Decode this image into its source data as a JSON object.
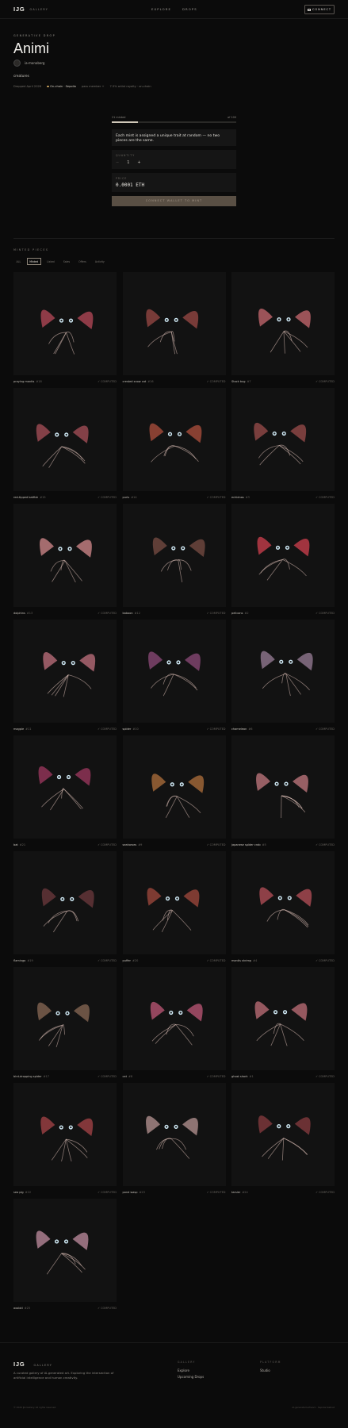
{
  "header": {
    "logo": "IJG",
    "logo_sub": "GALLERY",
    "nav": [
      "EXPLORE",
      "DROPS"
    ],
    "connect": "CONNECT"
  },
  "hero": {
    "eyebrow": "GENERATIVE DROP",
    "title": "Animi",
    "creator": "ia-monoberg",
    "description": "creatures",
    "meta": {
      "date": "Dropped April 2026",
      "onchain": "On-chain · Sepolia",
      "price": "pass member +",
      "royalty": "7.5% artist royalty · on-chain"
    }
  },
  "mint": {
    "minted": "21 minted",
    "supply": "of 100",
    "progress": 0.21,
    "note": "Each mint is assigned a unique trait at random — no two pieces are the same.",
    "quantity_label": "QUANTITY",
    "quantity": "1",
    "minus": "−",
    "plus": "+",
    "price_label": "PRICE",
    "price": "0.0001 ETH",
    "cta": "CONNECT WALLET TO MINT"
  },
  "pieces": {
    "label": "MINTED PIECES",
    "filters": [
      "ALL",
      "Minted",
      "Listed",
      "Sales",
      "Offers",
      "Activity"
    ],
    "active_filter": "Minted",
    "items": [
      {
        "name": "praying mantis",
        "num": "#18",
        "status": "COMPUTED",
        "hue": "#b84a5a"
      },
      {
        "name": "crested snow cat",
        "num": "#16",
        "status": "COMPUTED",
        "hue": "#9b4a46"
      },
      {
        "name": "Stock bug",
        "num": "#7",
        "status": "COMPUTED",
        "hue": "#c96a70"
      },
      {
        "name": "red-tipped batfish",
        "num": "#15",
        "status": "COMPUTED",
        "hue": "#a9505a"
      },
      {
        "name": "puris",
        "num": "#14",
        "status": "COMPUTED",
        "hue": "#b0503e"
      },
      {
        "name": "echidnas",
        "num": "#3",
        "status": "COMPUTED",
        "hue": "#9c4e4c"
      },
      {
        "name": "dolphins",
        "num": "#13",
        "status": "COMPUTED",
        "hue": "#d68b8e"
      },
      {
        "name": "baboon",
        "num": "#12",
        "status": "COMPUTED",
        "hue": "#7a4d44"
      },
      {
        "name": "pelicans",
        "num": "#2",
        "status": "COMPUTED",
        "hue": "#d2404f"
      },
      {
        "name": "magpie",
        "num": "#11",
        "status": "COMPUTED",
        "hue": "#c1727f"
      },
      {
        "name": "spider",
        "num": "#10",
        "status": "COMPUTED",
        "hue": "#8e4b7a"
      },
      {
        "name": "chameleon",
        "num": "#6",
        "status": "COMPUTED",
        "hue": "#9a7f98"
      },
      {
        "name": "bat",
        "num": "#21",
        "status": "COMPUTED",
        "hue": "#a03860"
      },
      {
        "name": "seahorses",
        "num": "#9",
        "status": "COMPUTED",
        "hue": "#b0703c"
      },
      {
        "name": "japanese spider crab",
        "num": "#5",
        "status": "COMPUTED",
        "hue": "#c47a80"
      },
      {
        "name": "flamingo",
        "num": "#19",
        "status": "COMPUTED",
        "hue": "#6e3a3e"
      },
      {
        "name": "puffer",
        "num": "#20",
        "status": "COMPUTED",
        "hue": "#a34a3e"
      },
      {
        "name": "mantis shrimp",
        "num": "#4",
        "status": "COMPUTED",
        "hue": "#b8505a"
      },
      {
        "name": "bird-dropping spider",
        "num": "#17",
        "status": "COMPUTED",
        "hue": "#8a6a56"
      },
      {
        "name": "cat",
        "num": "#8",
        "status": "COMPUTED",
        "hue": "#c05878"
      },
      {
        "name": "ghost shark",
        "num": "#1",
        "status": "COMPUTED",
        "hue": "#c2707a"
      },
      {
        "name": "sea pig",
        "num": "#22",
        "status": "COMPUTED",
        "hue": "#a84448"
      },
      {
        "name": "pond wasp",
        "num": "#23",
        "status": "COMPUTED",
        "hue": "#b89694"
      },
      {
        "name": "tarsier",
        "num": "#24",
        "status": "COMPUTED",
        "hue": "#8a3c40"
      },
      {
        "name": "axolotl",
        "num": "#25",
        "status": "COMPUTED",
        "hue": "#c08ea0"
      }
    ]
  },
  "footer": {
    "logo": "IJG",
    "logo_sub": "GALLERY",
    "tagline": "A curated gallery of AI-generated art. Exploring the intersection of artificial intelligence and human creativity.",
    "col1_head": "GALLERY",
    "col1_items": [
      "Explore",
      "Upcoming Drops"
    ],
    "col2_head": "PLATFORM",
    "col2_items": [
      "Studio"
    ],
    "copyright": "© 2026 IJG Gallery. All rights reserved.",
    "powered": "AI-generated artwork · Sepolia testnet"
  }
}
